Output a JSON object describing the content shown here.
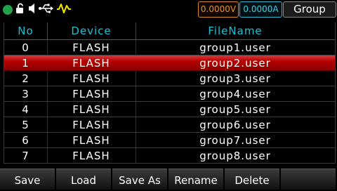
{
  "status": {
    "icons": [
      "status-led-icon",
      "unlock-icon",
      "speaker-icon",
      "usb-icon",
      "waveform-icon"
    ],
    "led_color": "#1fa24a",
    "voltage": "0.0000V",
    "current": "0.0000A",
    "mode": "Group"
  },
  "table": {
    "headers": {
      "no": "No",
      "device": "Device",
      "filename": "FileName"
    },
    "selected_index": 1,
    "rows": [
      {
        "no": "0",
        "device": "FLASH",
        "filename": "group1.user"
      },
      {
        "no": "1",
        "device": "FLASH",
        "filename": "group2.user"
      },
      {
        "no": "2",
        "device": "FLASH",
        "filename": "group3.user"
      },
      {
        "no": "3",
        "device": "FLASH",
        "filename": "group4.user"
      },
      {
        "no": "4",
        "device": "FLASH",
        "filename": "group5.user"
      },
      {
        "no": "5",
        "device": "FLASH",
        "filename": "group6.user"
      },
      {
        "no": "6",
        "device": "FLASH",
        "filename": "group7.user"
      },
      {
        "no": "7",
        "device": "FLASH",
        "filename": "group8.user"
      }
    ]
  },
  "softkeys": {
    "save": "Save",
    "load": "Load",
    "save_as": "Save As",
    "rename": "Rename",
    "delete": "Delete",
    "blank": ""
  },
  "colors": {
    "header_text": "#19c3d8",
    "voltage": "#e8922e",
    "current": "#3fd0e4",
    "selected_row": "#b40000"
  }
}
